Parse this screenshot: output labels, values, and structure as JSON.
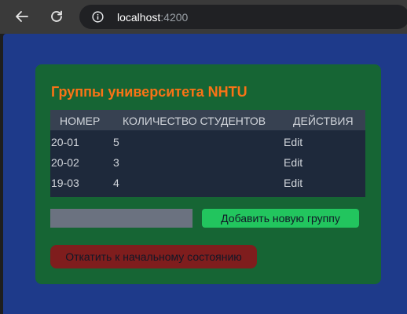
{
  "browser": {
    "url_host": "localhost",
    "url_port": ":4200",
    "icons": {
      "back": "arrow-left-icon",
      "reload": "reload-icon",
      "info": "info-icon"
    }
  },
  "page": {
    "title": "Группы университета NHTU",
    "table": {
      "headers": [
        "НОМЕР",
        "КОЛИЧЕСТВО СТУДЕНТОВ",
        "ДЕЙСТВИЯ"
      ],
      "rows": [
        {
          "number": "20-01",
          "students": "5",
          "action": "Edit"
        },
        {
          "number": "20-02",
          "students": "3",
          "action": "Edit"
        },
        {
          "number": "19-03",
          "students": "4",
          "action": "Edit"
        }
      ]
    },
    "new_group_input": {
      "value": "",
      "placeholder": ""
    },
    "add_button_label": "Добавить новую группу",
    "reset_button_label": "Откатить к начальному состоянию"
  },
  "colors": {
    "page_background": "#1e3a8a",
    "card_background": "#166534",
    "title": "#f97316",
    "table_header": "#374151",
    "table_body": "#1e293b",
    "add_button": "#22c55e",
    "reset_button": "#7f1d1d"
  }
}
